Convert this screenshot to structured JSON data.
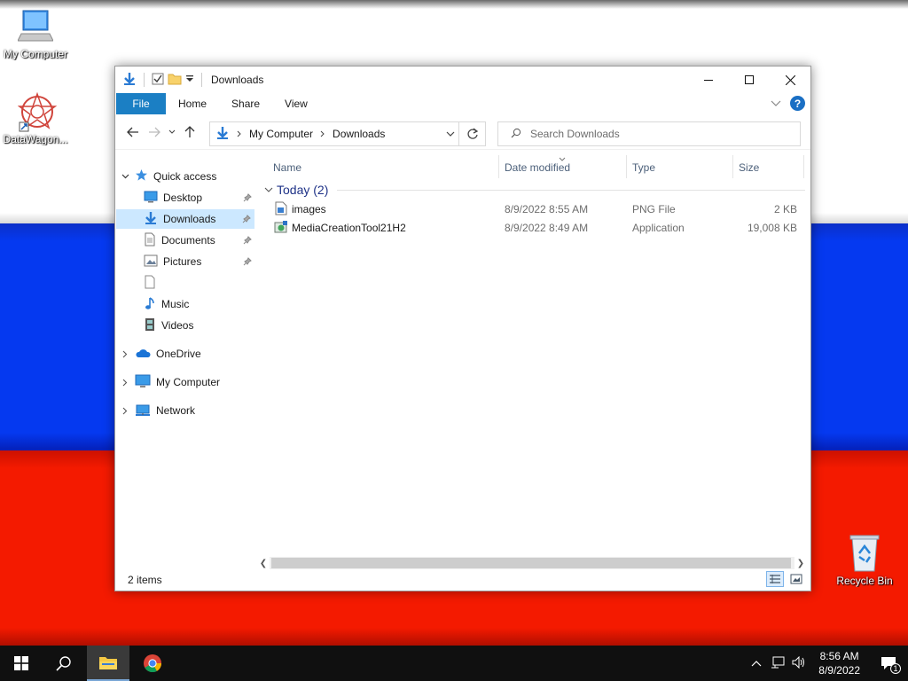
{
  "desktop": {
    "icons": [
      {
        "label": "My Computer"
      },
      {
        "label": "DataWagon..."
      },
      {
        "label": "Recycle Bin"
      }
    ]
  },
  "window": {
    "title": "Downloads",
    "ribbon_tabs": [
      "File",
      "Home",
      "Share",
      "View"
    ],
    "help": "?",
    "address": {
      "crumbs": [
        "My Computer",
        "Downloads"
      ]
    },
    "search_placeholder": "Search Downloads",
    "nav": {
      "quick_access": "Quick access",
      "items": [
        "Desktop",
        "Downloads",
        "Documents",
        "Pictures",
        "",
        "Music",
        "Videos"
      ],
      "onedrive": "OneDrive",
      "my_computer": "My Computer",
      "network": "Network"
    },
    "columns": [
      "Name",
      "Date modified",
      "Type",
      "Size"
    ],
    "group": "Today (2)",
    "files": [
      {
        "name": "images",
        "date": "8/9/2022 8:55 AM",
        "type": "PNG File",
        "size": "2 KB"
      },
      {
        "name": "MediaCreationTool21H2",
        "date": "8/9/2022 8:49 AM",
        "type": "Application",
        "size": "19,008 KB"
      }
    ],
    "status": "2 items"
  },
  "taskbar": {
    "time": "8:56 AM",
    "date": "8/9/2022",
    "notification_count": "1"
  },
  "colors": {
    "accent": "#1b7fc4",
    "selection": "#cce8ff",
    "group_text": "#1e3287"
  }
}
